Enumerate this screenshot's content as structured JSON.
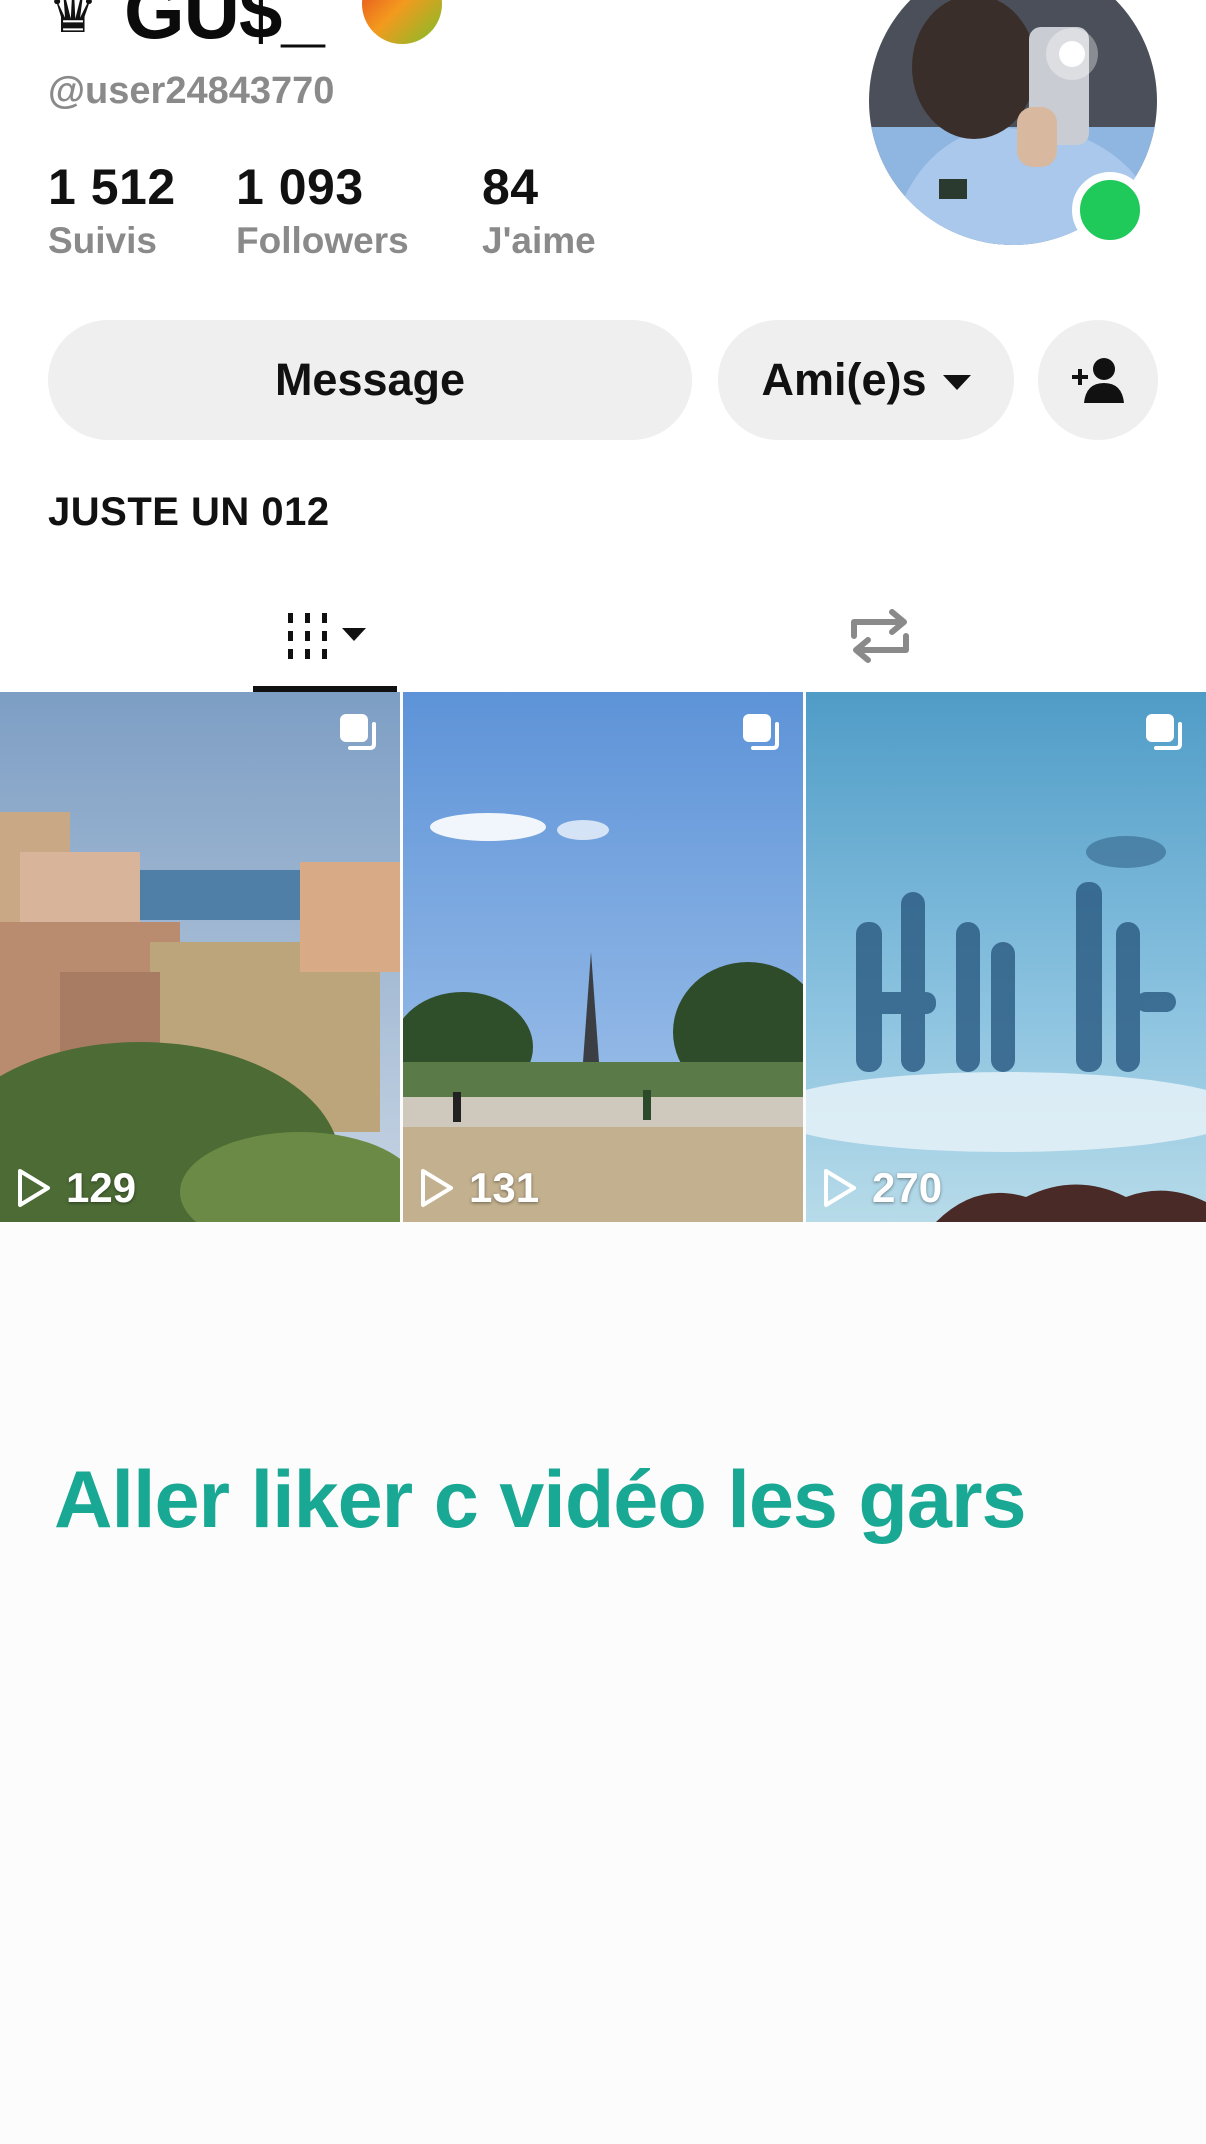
{
  "profile": {
    "crown": "♛",
    "display_name": "GU$_",
    "emoji_icon": "mango-emoji-icon",
    "handle": "@user24843770",
    "online_color": "#1fc95a"
  },
  "stats": [
    {
      "value": "1 512",
      "label": "Suivis"
    },
    {
      "value": "1 093",
      "label": "Followers"
    },
    {
      "value": "84",
      "label": "J'aime"
    }
  ],
  "actions": {
    "message_label": "Message",
    "friends_label": "Ami(e)s",
    "add_user_icon": "add-user-icon"
  },
  "bio": "JUSTE UN 012",
  "tabs": {
    "videos_icon": "video-grid-icon",
    "reposts_icon": "repost-icon"
  },
  "videos": [
    {
      "views": "129",
      "scene": "coastal-village"
    },
    {
      "views": "131",
      "scene": "eiffel-tower-park"
    },
    {
      "views": "270",
      "scene": "cloud-letters-sky"
    }
  ],
  "caption": {
    "text": "Aller liker c vidéo les gars",
    "color": "#19a893"
  }
}
